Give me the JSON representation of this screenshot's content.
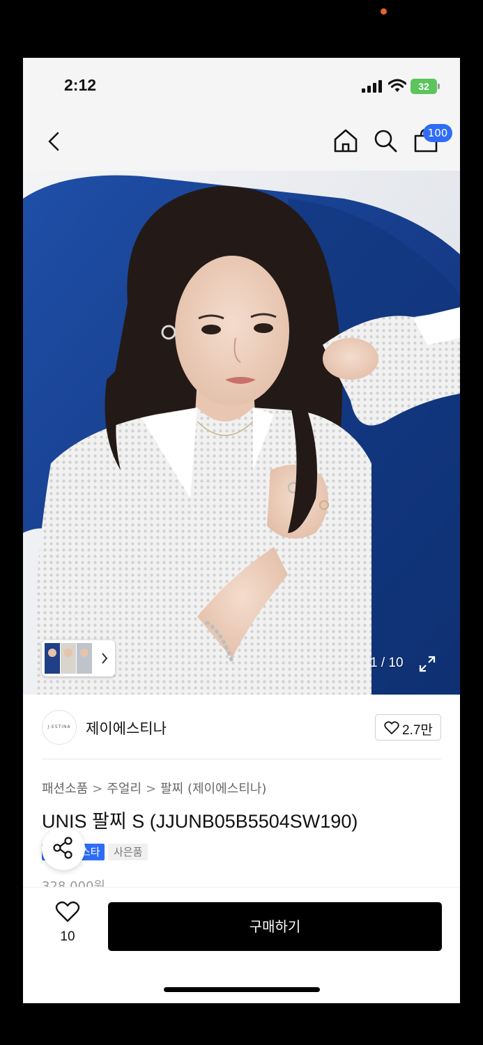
{
  "status_bar": {
    "time": "2:12",
    "battery": "32"
  },
  "nav": {
    "cart_count": "100",
    "icons": [
      "back-arrow-icon",
      "home-icon",
      "search-icon",
      "shopping-bag-icon"
    ]
  },
  "hero": {
    "counter": "1 / 10",
    "expand_icon": "expand-icon"
  },
  "brand": {
    "logo_text": "J·ESTINA",
    "name": "제이에스티나",
    "like_count": "2.7만"
  },
  "breadcrumb": [
    "패션소품",
    "주얼리",
    "팔찌 (제이에스티나)"
  ],
  "product": {
    "title": "UNIS 팔찌 S (JJUNB05B5504SW190)",
    "tags": [
      "스타",
      "사은품"
    ],
    "price": "328,000원"
  },
  "bottom_bar": {
    "wish_count": "10",
    "buy_label": "구매하기"
  },
  "colors": {
    "accent_blue": "#2f6df6",
    "buy_button": "#000000",
    "status_orange": "#e8632b",
    "battery_green": "#5cc45c"
  }
}
